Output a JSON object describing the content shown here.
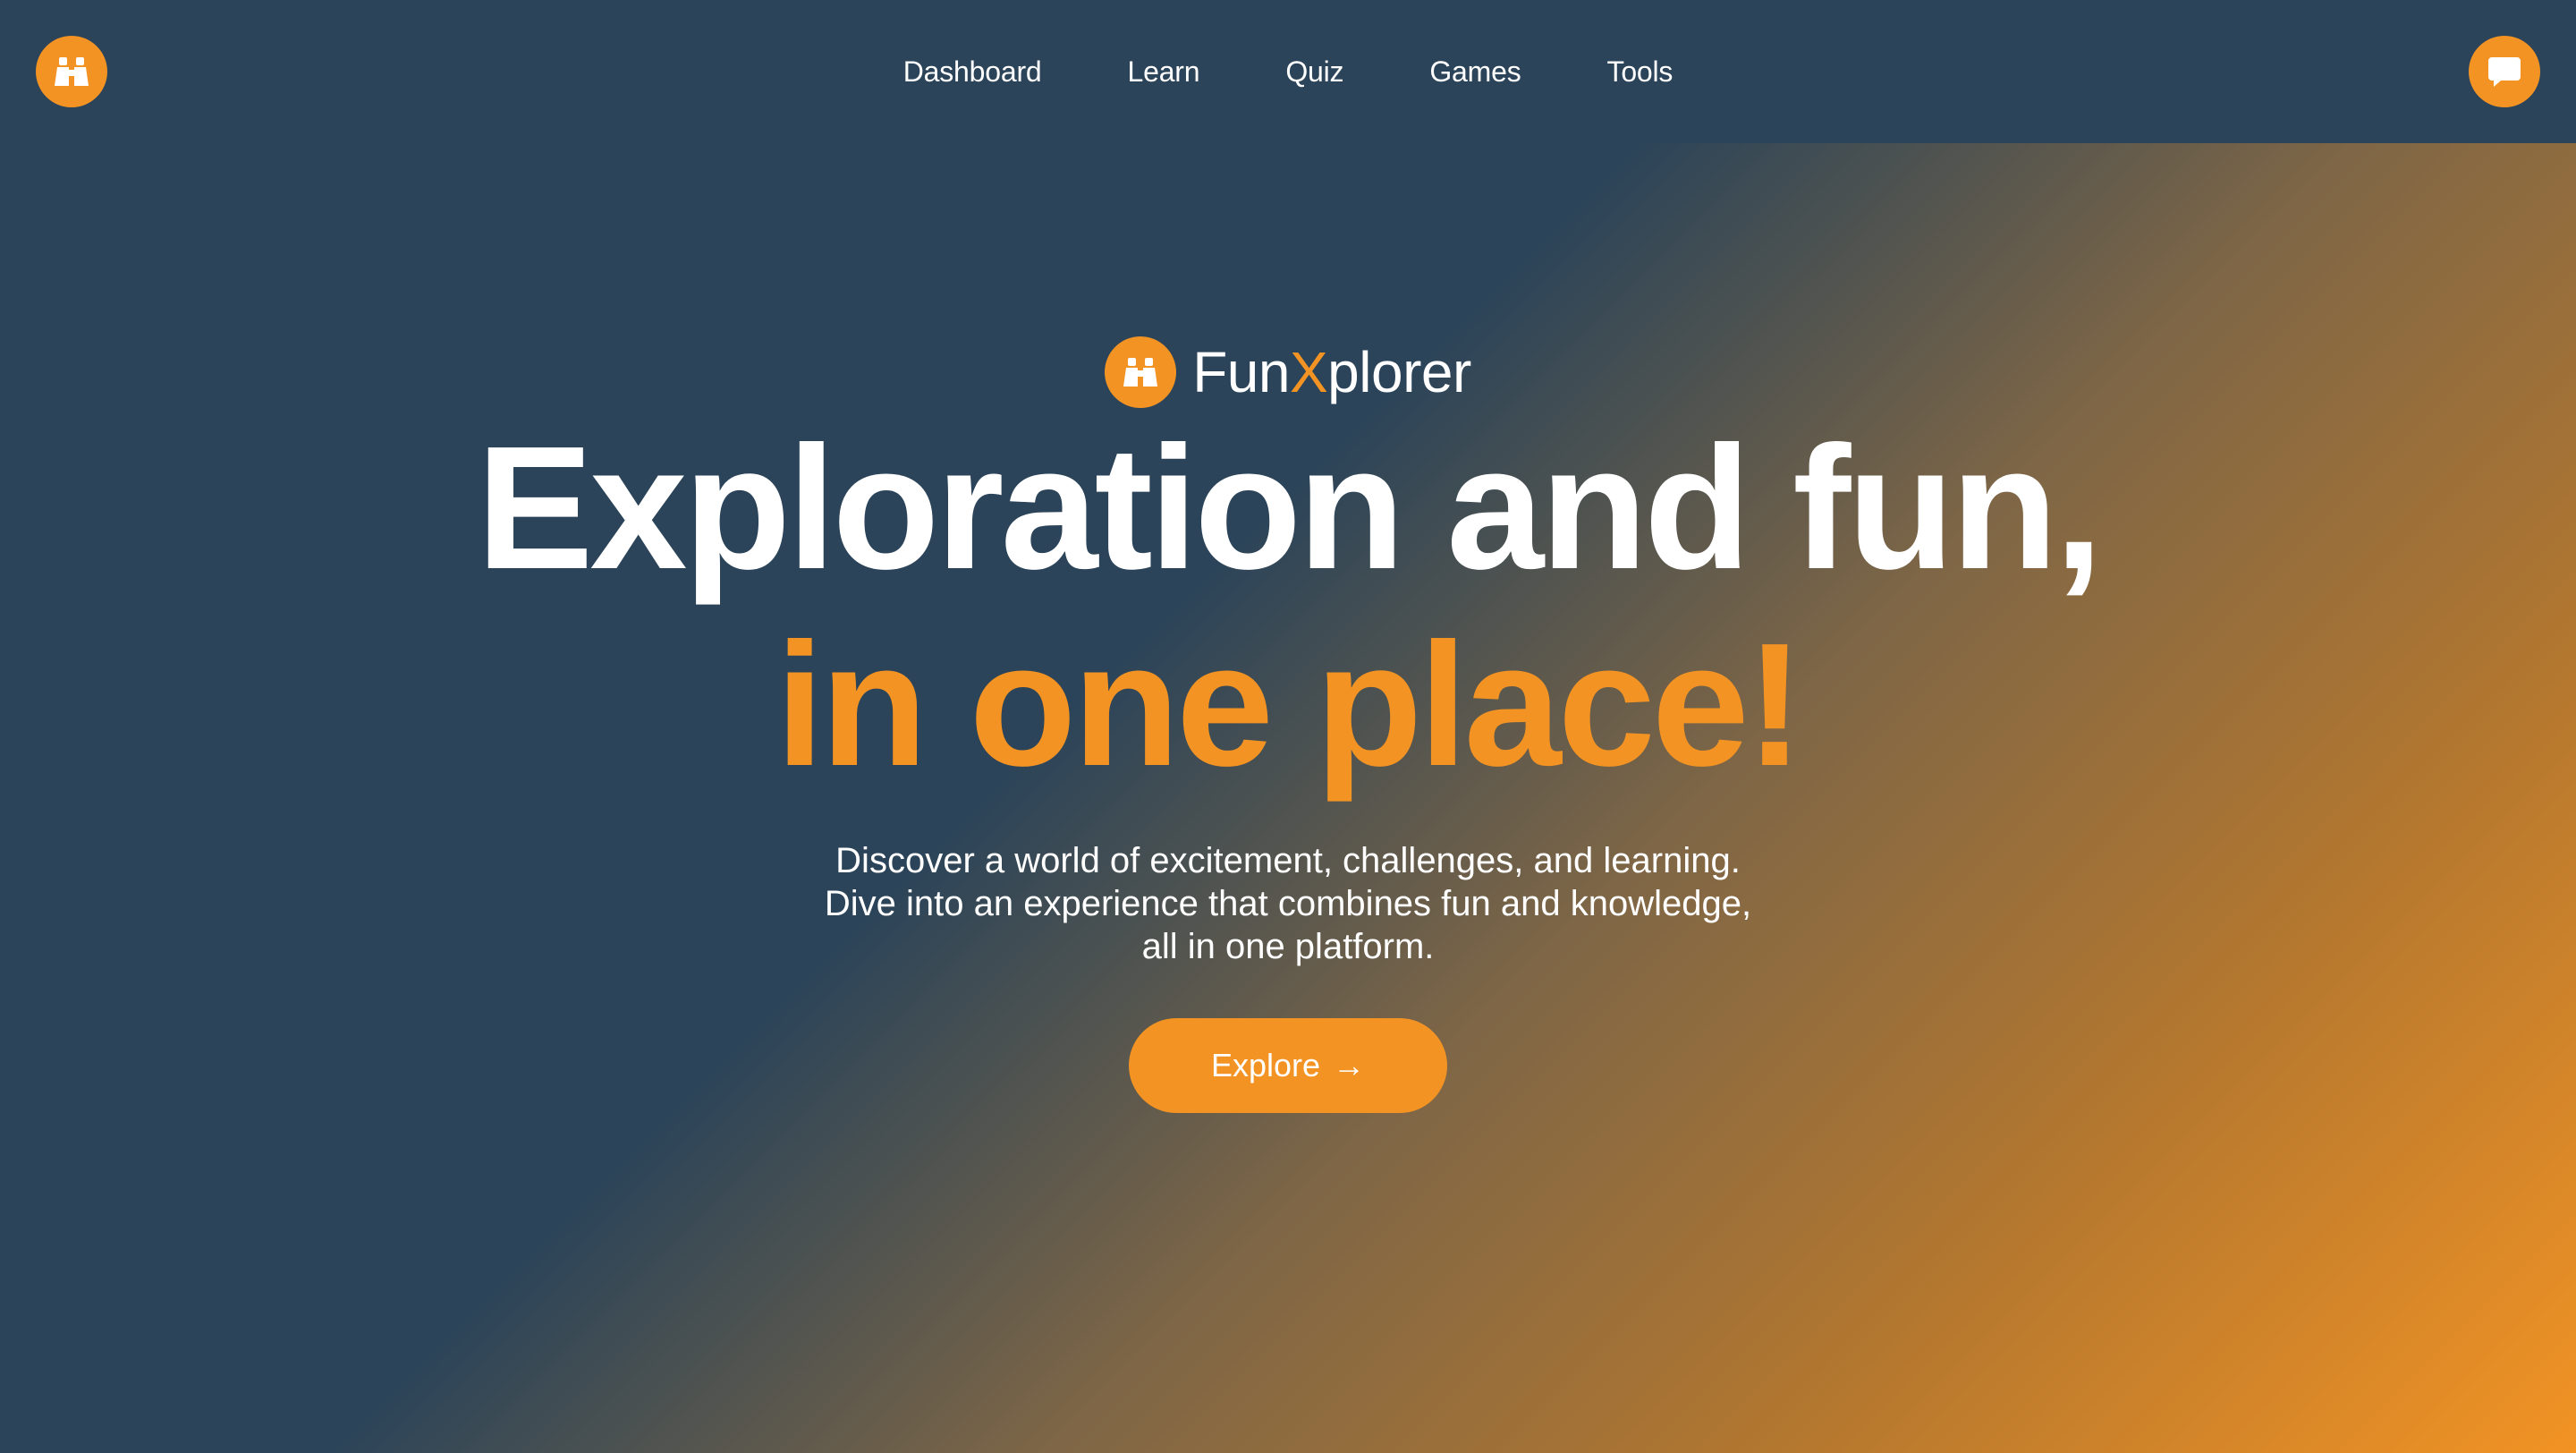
{
  "colors": {
    "accent": "#f29324",
    "navy": "#2b4459",
    "text": "#ffffff"
  },
  "header": {
    "logo_icon": "binoculars-icon",
    "chat_icon": "chat-bubble-icon",
    "nav": [
      {
        "label": "Dashboard"
      },
      {
        "label": "Learn"
      },
      {
        "label": "Quiz"
      },
      {
        "label": "Games"
      },
      {
        "label": "Tools"
      }
    ]
  },
  "hero": {
    "brand_icon": "binoculars-icon",
    "brand_prefix": "Fun",
    "brand_x": "X",
    "brand_suffix": "plorer",
    "headline_line1": "Exploration and fun,",
    "headline_line2": "in one place!",
    "description_lines": [
      "Discover a world of excitement, challenges, and learning.",
      "Dive into an experience that combines fun and knowledge,",
      "all in one platform."
    ],
    "cta_label": "Explore",
    "cta_arrow": "→"
  }
}
